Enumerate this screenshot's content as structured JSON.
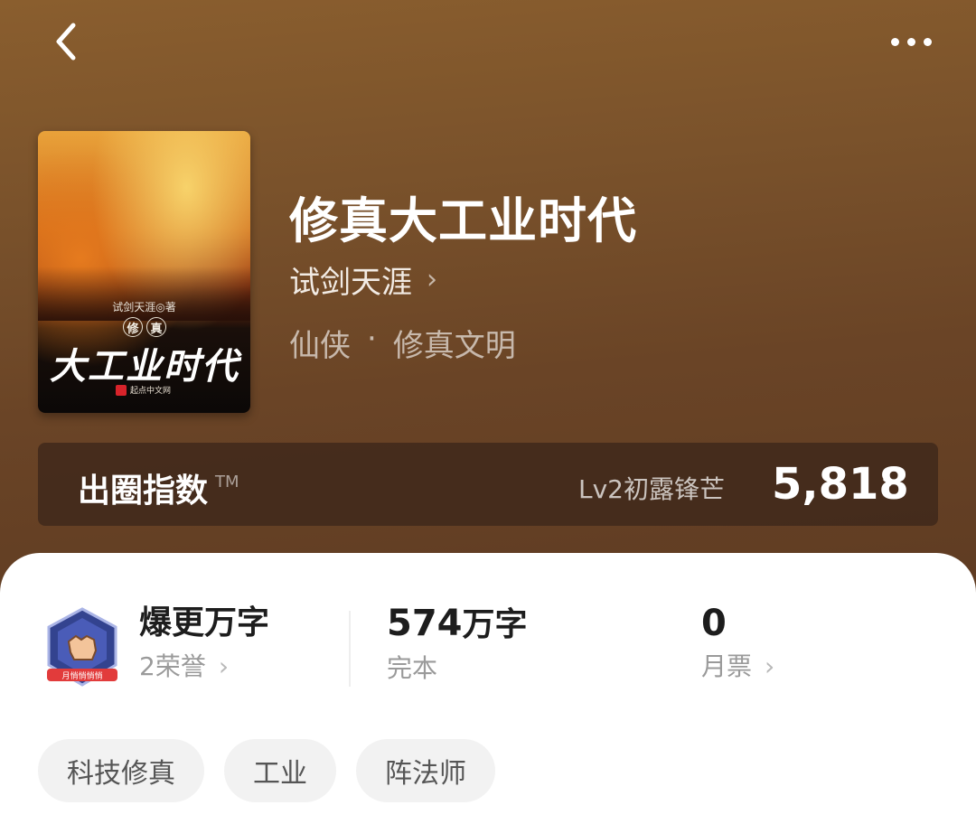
{
  "nav": {
    "back_icon": "chevron-left-icon",
    "more_icon": "more-dots-icon"
  },
  "book": {
    "title": "修真大工业时代",
    "author": "试剑天涯",
    "genre_primary": "仙侠",
    "genre_separator": "·",
    "genre_secondary": "修真文明",
    "cover": {
      "author_line": "试剑天涯◎著",
      "seal_chars": [
        "修",
        "真"
      ],
      "title": "大工业时代",
      "publisher": "起点中文网"
    }
  },
  "index": {
    "label": "出圈指数",
    "tm": "TM",
    "level": "Lv2初露锋芒",
    "value": "5,818"
  },
  "stats": {
    "honor_title": "爆更万字",
    "honor_sub": "2荣誉",
    "badge_text": "月悄悄悄悄",
    "words_num": "574",
    "words_unit": "万字",
    "words_sub": "完本",
    "ticket_value": "0",
    "ticket_sub": "月票"
  },
  "tags": [
    "科技修真",
    "工业",
    "阵法师"
  ],
  "colors": {
    "hero": "#7a522b",
    "badge": "#2f3f8a",
    "tag_bg": "#f2f2f2"
  }
}
